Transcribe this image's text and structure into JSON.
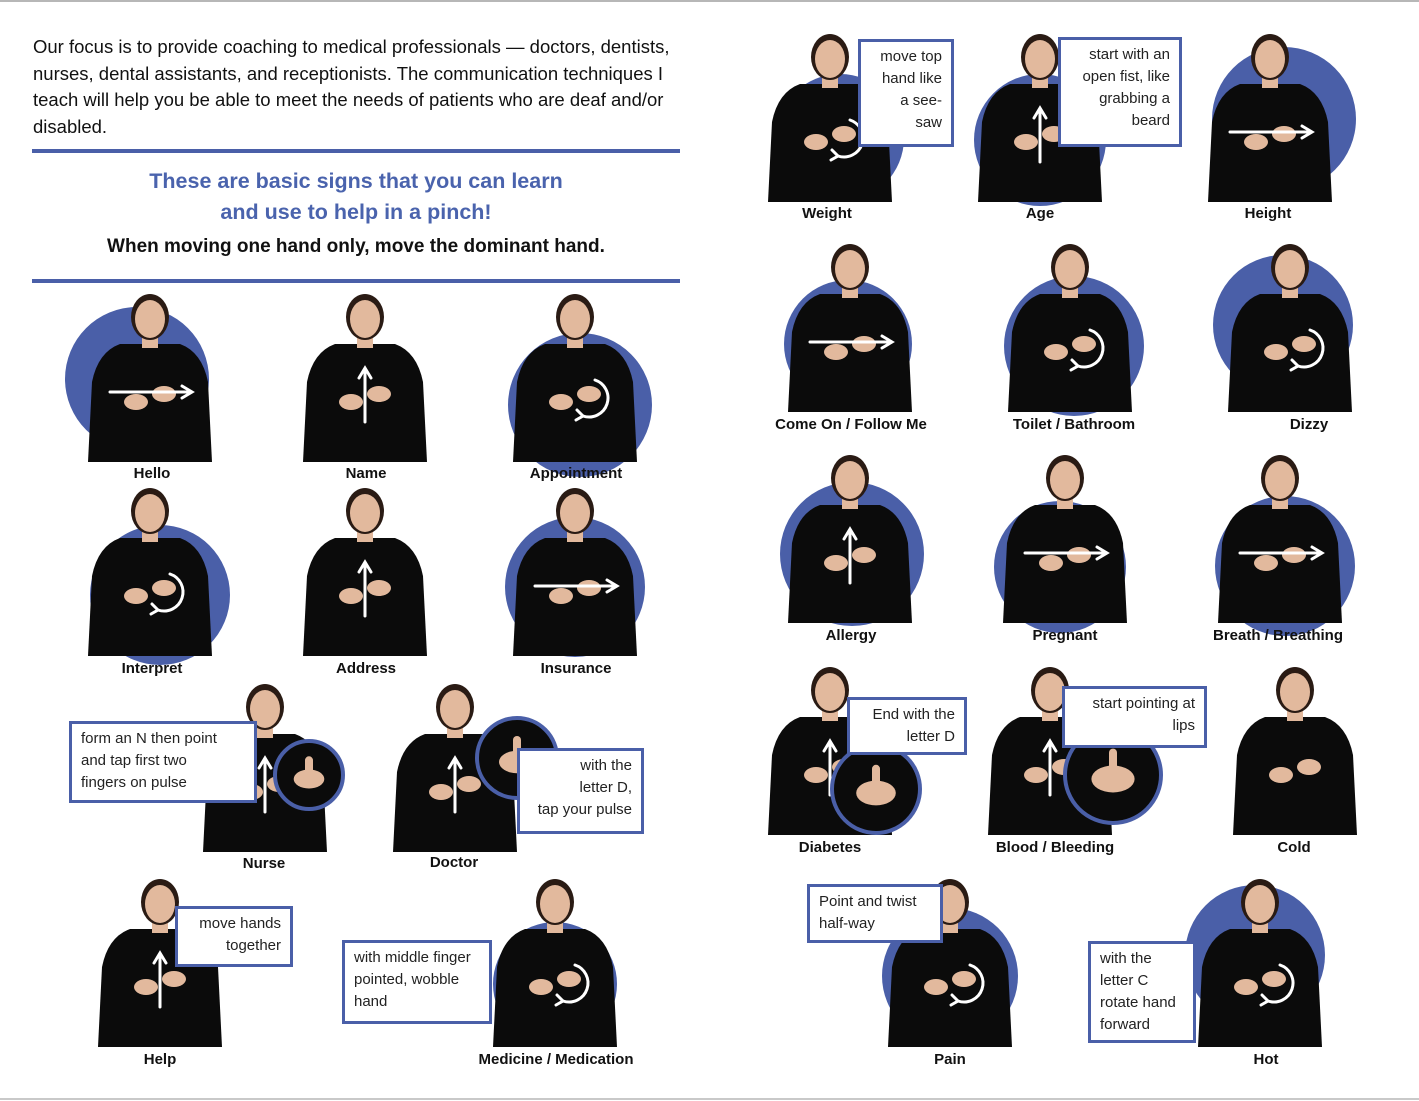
{
  "intro": "Our focus is to provide coaching to medical professionals — doctors, dentists, nurses, dental assistants, and receptionists.  The communication techniques I teach will help you be able to meet the needs of patients who are deaf and/or disabled.",
  "headline_line1": "These are basic signs that you can learn",
  "headline_line2": "and use to help in a pinch!",
  "subheading": "When moving one hand only, move the dominant hand.",
  "colors": {
    "accent": "#4a5fa8",
    "headline": "#4a63ad",
    "shirt": "#0b0b0b",
    "skin": "#e2b99d",
    "hair": "#2a1b14"
  },
  "signs": {
    "hello": "Hello",
    "name": "Name",
    "appointment": "Appointment",
    "interpret": "Interpret",
    "address": "Address",
    "insurance": "Insurance",
    "nurse": "Nurse",
    "doctor": "Doctor",
    "help": "Help",
    "medicine": "Medicine / Medication",
    "weight": "Weight",
    "age": "Age",
    "height": "Height",
    "come_on": "Come On / Follow Me",
    "toilet": "Toilet / Bathroom",
    "dizzy": "Dizzy",
    "allergy": "Allergy",
    "pregnant": "Pregnant",
    "breath": "Breath / Breathing",
    "diabetes": "Diabetes",
    "blood": "Blood / Bleeding",
    "cold": "Cold",
    "pain": "Pain",
    "hot": "Hot"
  },
  "notes": {
    "nurse": [
      "form an N then point",
      "and tap first two",
      "fingers on pulse"
    ],
    "doctor": [
      "with the",
      "letter D,",
      "tap your pulse"
    ],
    "help": [
      "move hands",
      "together"
    ],
    "medicine": [
      "with middle finger",
      "pointed, wobble",
      "hand"
    ],
    "weight": [
      "move top",
      "hand like",
      "a see-",
      "saw"
    ],
    "age": [
      "start with an",
      "open fist, like",
      "grabbing a",
      "beard"
    ],
    "diabetes": [
      "End with the",
      "letter D"
    ],
    "blood": [
      "start pointing at",
      "lips"
    ],
    "pain": [
      "Point and twist",
      "half-way"
    ],
    "hot": [
      "with the",
      "letter C",
      "rotate hand",
      "forward"
    ]
  }
}
